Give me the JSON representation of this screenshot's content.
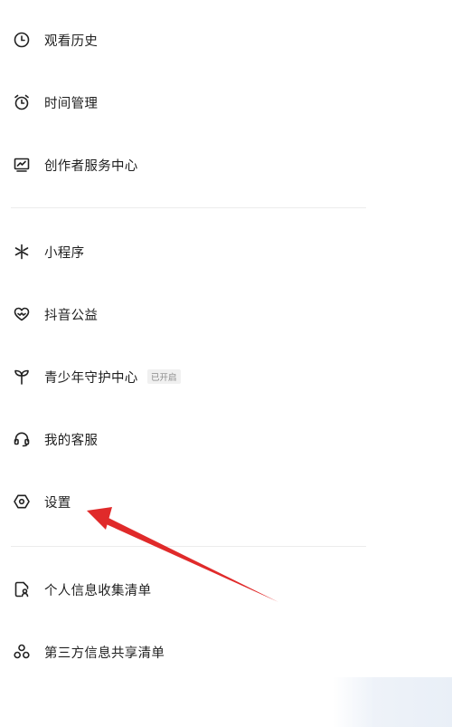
{
  "menu": {
    "items": [
      {
        "label": "观看历史",
        "icon": "clock-icon"
      },
      {
        "label": "时间管理",
        "icon": "alarm-clock-icon"
      },
      {
        "label": "创作者服务中心",
        "icon": "monitor-chart-icon"
      },
      {
        "label": "小程序",
        "icon": "mini-program-icon"
      },
      {
        "label": "抖音公益",
        "icon": "charity-heart-icon"
      },
      {
        "label": "青少年守护中心",
        "icon": "sprout-icon",
        "badge": "已开启"
      },
      {
        "label": "我的客服",
        "icon": "headset-icon"
      },
      {
        "label": "设置",
        "icon": "settings-hexagon-icon"
      },
      {
        "label": "个人信息收集清单",
        "icon": "document-person-icon"
      },
      {
        "label": "第三方信息共享清单",
        "icon": "share-nodes-icon"
      }
    ]
  },
  "annotation": {
    "arrow_color": "#e02a2a",
    "points_to": "设置"
  }
}
